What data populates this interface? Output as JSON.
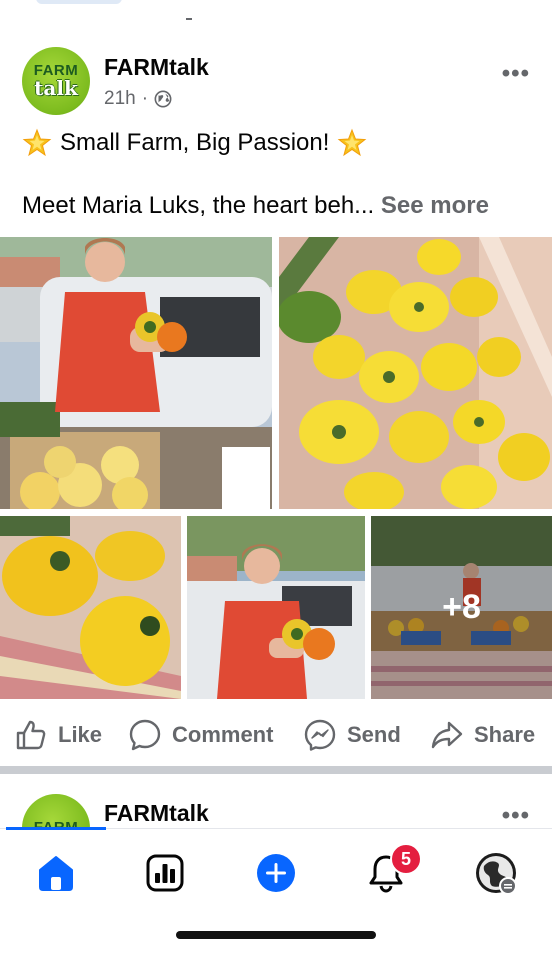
{
  "post": {
    "page_name": "FARMtalk",
    "avatar_line1": "FARM",
    "avatar_line2": "talk",
    "time": "21h",
    "separator": "·",
    "more": "•••",
    "caption_line1": "Small Farm, Big Passion!",
    "caption_line2": "Meet Maria Luks, the heart beh...",
    "see_more": "See more",
    "extra_photos": "+8"
  },
  "actions": [
    {
      "label": "Like",
      "icon": "thumbs-up-icon"
    },
    {
      "label": "Comment",
      "icon": "comment-bubble-icon"
    },
    {
      "label": "Send",
      "icon": "messenger-icon"
    },
    {
      "label": "Share",
      "icon": "share-arrow-icon"
    }
  ],
  "next_post": {
    "page_name": "FARMtalk",
    "avatar_line1": "FARM",
    "more": "•••"
  },
  "tabbar": {
    "tabs": [
      "home-icon",
      "dashboard-icon",
      "create-icon",
      "notifications-icon",
      "profile-icon"
    ],
    "notification_count": "5",
    "accent": "#0866ff",
    "badge_color": "#e41e3f"
  }
}
